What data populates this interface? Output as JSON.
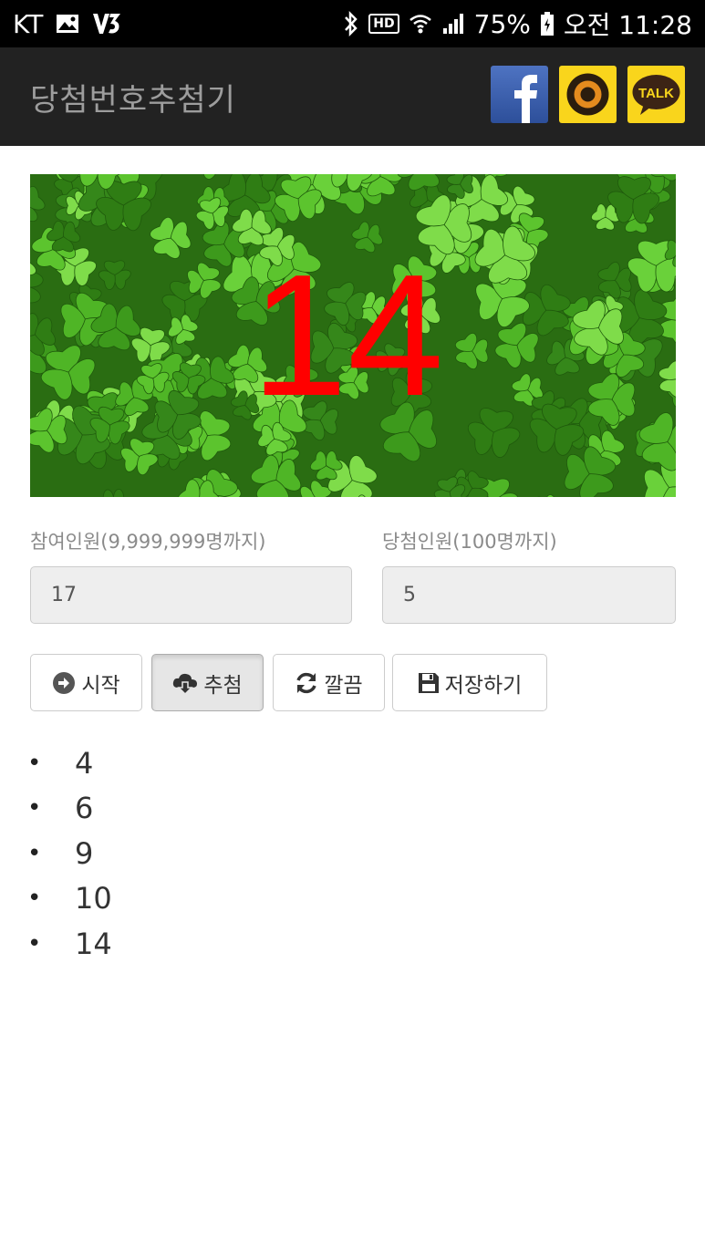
{
  "status_bar": {
    "carrier": "KT",
    "hd": "HD",
    "battery": "75%",
    "time": "오전 11:28"
  },
  "app_bar": {
    "title": "당첨번호추첨기",
    "share": [
      {
        "name": "facebook",
        "icon": "facebook-icon"
      },
      {
        "name": "kakaostory",
        "icon": "kakaostory-icon"
      },
      {
        "name": "kakaotalk",
        "icon": "kakaotalk-icon",
        "label": "TALK"
      }
    ]
  },
  "banner": {
    "number": "14",
    "number_color": "#ff0000"
  },
  "form": {
    "participants_label": "참여인원(9,999,999명까지)",
    "participants_value": "17",
    "winners_label": "당첨인원(100명까지)",
    "winners_value": "5"
  },
  "buttons": {
    "start": {
      "label": "시작",
      "icon": "arrow-circle-right-icon"
    },
    "draw": {
      "label": "추첨",
      "icon": "cloud-download-icon"
    },
    "clear": {
      "label": "깔끔",
      "icon": "refresh-icon"
    },
    "save": {
      "label": "저장하기",
      "icon": "floppy-disk-icon"
    }
  },
  "results": [
    "4",
    "6",
    "9",
    "10",
    "14"
  ]
}
